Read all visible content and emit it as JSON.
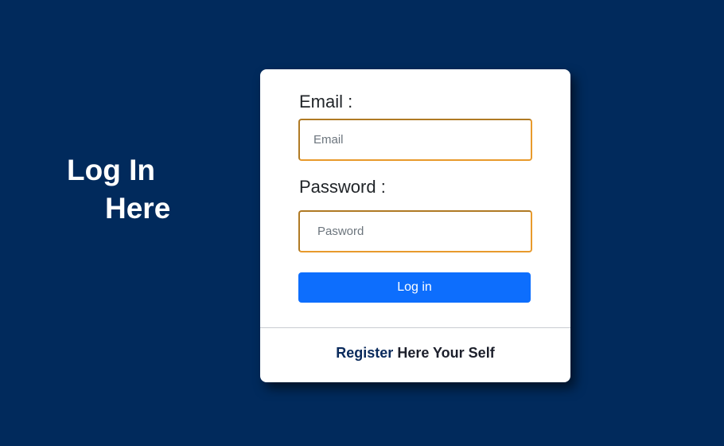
{
  "hero": {
    "line1": "Log In",
    "line2": "Here"
  },
  "form": {
    "email_label": "Email :",
    "email_placeholder": "Email",
    "email_value": "",
    "password_label": "Password :",
    "password_placeholder": "Pasword",
    "password_value": "",
    "submit_label": "Log in"
  },
  "footer": {
    "register_link": "Register",
    "register_rest": " Here Your Self"
  },
  "colors": {
    "background": "#012a5c",
    "card": "#ffffff",
    "primary_button": "#0d6efd",
    "input_border": "#e89a2c"
  }
}
